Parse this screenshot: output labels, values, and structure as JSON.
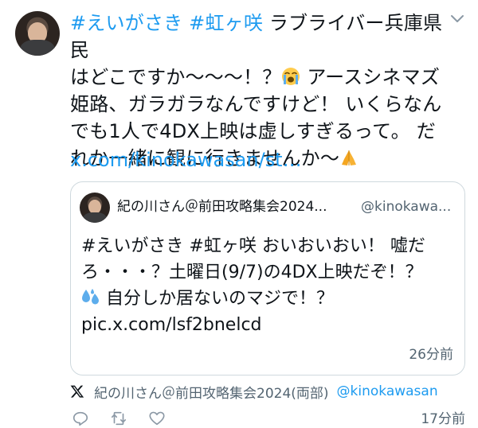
{
  "post": {
    "hashtag1": "#えいがさき",
    "hashtag2": "#虹ヶ咲",
    "text_line1_rest": " ラブライバー兵庫県民",
    "text_line2": "はどこですか〜〜〜！？",
    "text_line2_after": " アースシネマズ",
    "text_line3": "姫路、ガラガラなんですけど！ いくらなん",
    "text_line4": "でも1人で4DX上映は虚しすぎるって。 だ",
    "text_line5": "れか一緒に観に行きませんか〜",
    "link": "x.com/kinokawasan/st…",
    "emoji_crying": "loudly-crying-face-icon",
    "emoji_pray": "folded-hands-icon"
  },
  "quote": {
    "name": "紀の川さん＠前田攻略集会2024...",
    "handle": "@kinokawa...",
    "text_line1": "#えいがさき #虹ヶ咲 おいおいおい！ 嘘だ",
    "text_line2": "ろ・・・？土曜日(9/7)の4DX上映だぞ！？",
    "text_line3": " 自分しか居ないのマジで！？",
    "text_line4": "pic.x.com/lsf2bnelcd",
    "time": "26分前",
    "emoji_sweat": "sweat-droplets-icon"
  },
  "footer": {
    "attribution_name": "紀の川さん＠前田攻略集会2024(両部)",
    "attribution_handle": "@kinokawasan",
    "time": "17分前"
  },
  "colors": {
    "accent": "#1d9bf0",
    "text": "#0f1419",
    "muted": "#536471",
    "border": "#cfd9de"
  }
}
